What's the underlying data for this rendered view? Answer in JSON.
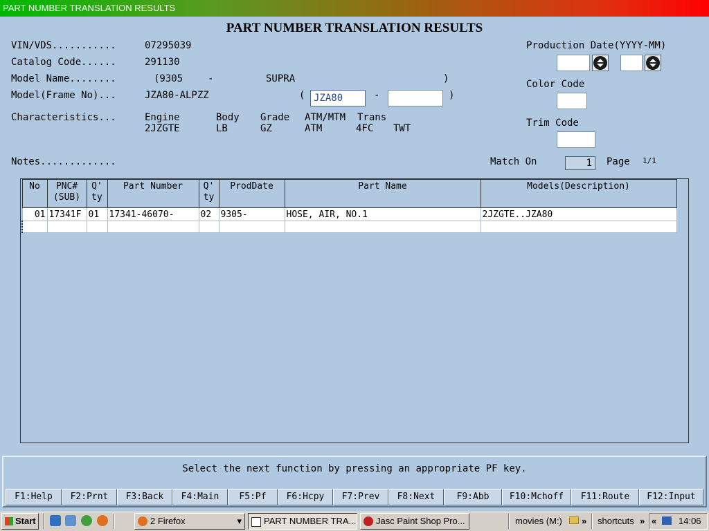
{
  "window": {
    "title": "PART NUMBER TRANSLATION RESULTS"
  },
  "heading": "PART NUMBER TRANSLATION RESULTS",
  "info": {
    "vin_label": "VIN/VDS...........",
    "vin_value": "07295039",
    "catalog_label": "Catalog Code......",
    "catalog_value": "291130",
    "model_name_label": "Model Name........",
    "model_name_open": "(9305",
    "model_name_dash": "-",
    "model_name_value": "SUPRA",
    "model_name_close": ")",
    "frame_label": "Model(Frame No)...",
    "frame_value": "JZA80-ALPZZ",
    "frame_open": "(",
    "frame_input1": "JZA80",
    "frame_dash": "-",
    "frame_close": ")",
    "characteristics_label": "Characteristics...",
    "notes_label": "Notes.............",
    "characteristics": [
      {
        "header": "Engine",
        "value": "2JZGTE"
      },
      {
        "header": "Body",
        "value": "LB"
      },
      {
        "header": "Grade",
        "value": "GZ"
      },
      {
        "header": "ATM/MTM",
        "value": "ATM"
      },
      {
        "header": "Trans",
        "value": "4FC"
      },
      {
        "header": "",
        "value": "TWT"
      }
    ]
  },
  "right_panel": {
    "production_label": "Production Date(YYYY-MM)",
    "color_label": "Color Code",
    "trim_label": "Trim Code",
    "match_label": "Match On",
    "match_value": "1",
    "page_label": "Page",
    "page_value": "1/1"
  },
  "grid": {
    "columns": [
      {
        "h1": "No",
        "h2": ""
      },
      {
        "h1": "PNC#",
        "h2": "(SUB)"
      },
      {
        "h1": "Q'",
        "h2": "ty"
      },
      {
        "h1": "Part Number",
        "h2": ""
      },
      {
        "h1": "Q'",
        "h2": "ty"
      },
      {
        "h1": "ProdDate",
        "h2": ""
      },
      {
        "h1": "Part Name",
        "h2": ""
      },
      {
        "h1": "Models(Description)",
        "h2": ""
      }
    ],
    "rows": [
      [
        "01",
        "17341F",
        "01",
        "17341-46070-",
        "02",
        "9305-",
        "HOSE, AIR, NO.1",
        "2JZGTE..JZA80"
      ]
    ]
  },
  "prompt": "Select the next function by pressing an appropriate PF key.",
  "fkeys": [
    "F1:Help",
    "F2:Prnt",
    "F3:Back",
    "F4:Main",
    "F5:Pf",
    "F6:Hcpy",
    "F7:Prev",
    "F8:Next",
    "F9:Abb",
    "F10:Mchoff",
    "F11:Route",
    "F12:Input"
  ],
  "taskbar": {
    "start": "Start",
    "firefox_group": "2 Firefox",
    "active_window": "PART NUMBER TRA...",
    "paintshop": "Jasc Paint Shop Pro...",
    "movies": "movies (M:)",
    "shortcuts": "shortcuts",
    "clock": "14:06"
  }
}
